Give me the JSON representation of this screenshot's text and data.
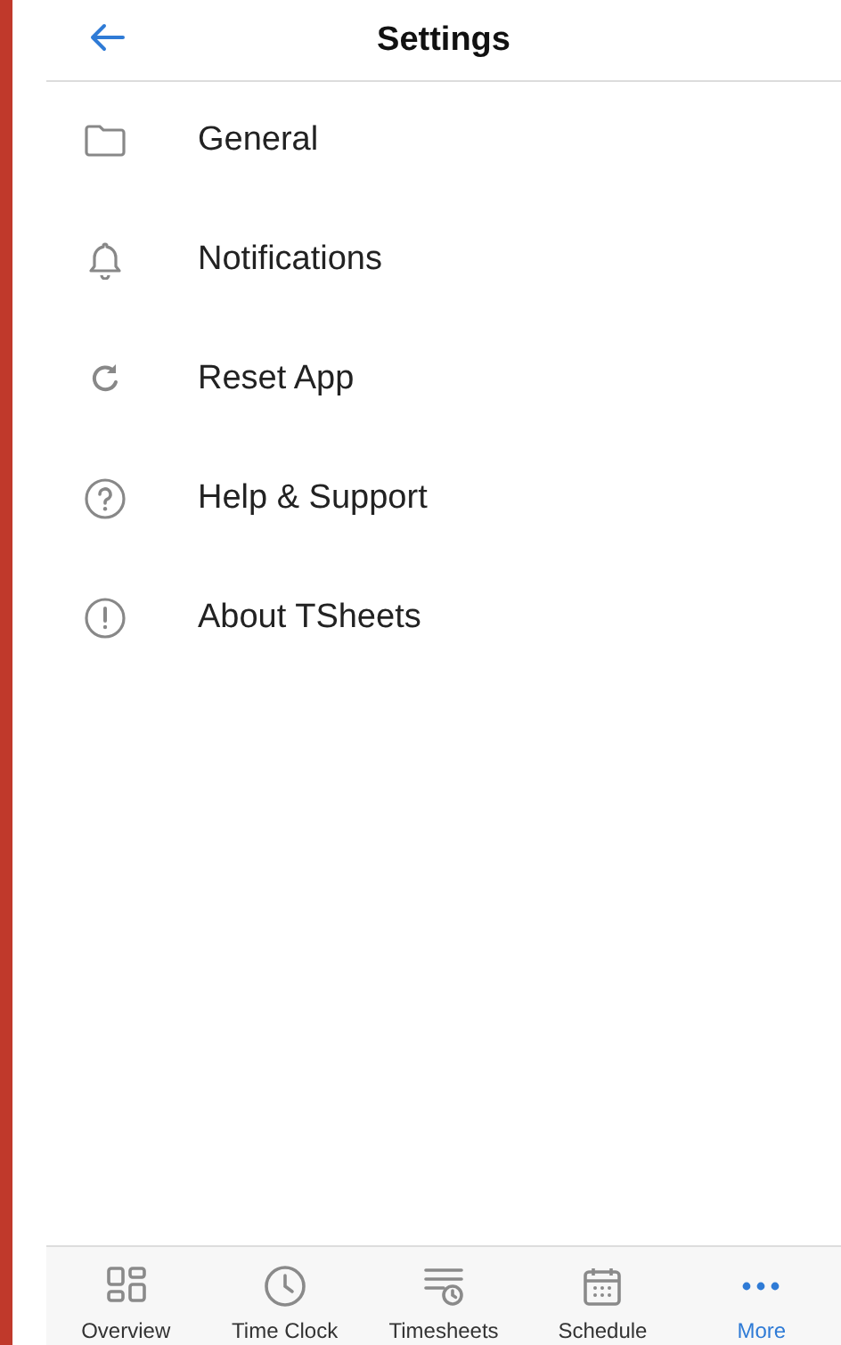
{
  "header": {
    "title": "Settings"
  },
  "items": [
    {
      "kind": "folder",
      "label": "General"
    },
    {
      "kind": "bell",
      "label": "Notifications"
    },
    {
      "kind": "refresh",
      "label": "Reset App"
    },
    {
      "kind": "help",
      "label": "Help & Support"
    },
    {
      "kind": "info",
      "label": "About TSheets"
    }
  ],
  "tabs": [
    {
      "kind": "overview",
      "label": "Overview",
      "selected": false
    },
    {
      "kind": "clock",
      "label": "Time Clock",
      "selected": false
    },
    {
      "kind": "timesheets",
      "label": "Timesheets",
      "selected": false
    },
    {
      "kind": "schedule",
      "label": "Schedule",
      "selected": false
    },
    {
      "kind": "more",
      "label": "More",
      "selected": true
    }
  ]
}
